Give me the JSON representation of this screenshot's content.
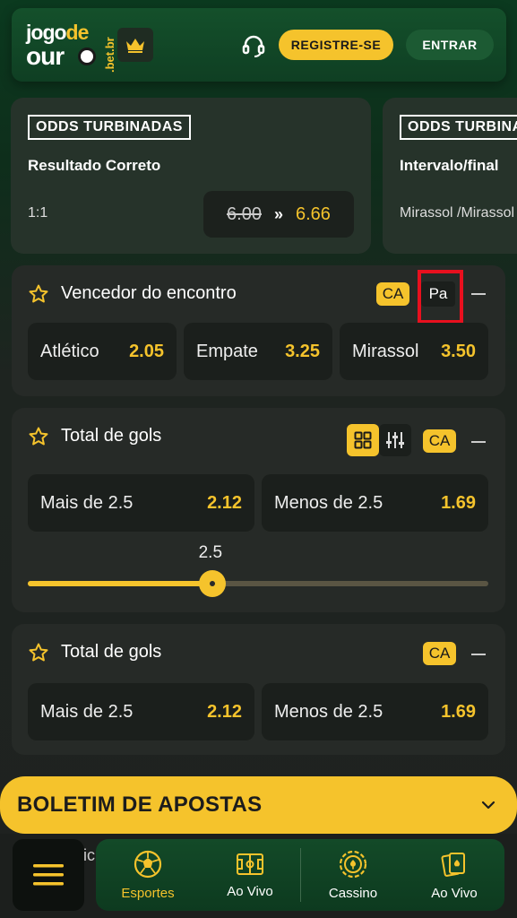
{
  "header": {
    "logo_line1_a": "jogo",
    "logo_line1_b": "de",
    "logo_line2": "our",
    "logo_suffix": ".bet.br",
    "register_label": "REGISTRE-SE",
    "login_label": "ENTRAR",
    "support_icon": "headset-icon",
    "crown_icon": "crown-icon"
  },
  "promos": [
    {
      "tag": "ODDS TURBINADAS",
      "title": "Resultado Correto",
      "selection": "1:1",
      "old_odd": "6.00",
      "arrow": "»",
      "new_odd": "6.66"
    },
    {
      "tag": "ODDS TURBINADAS",
      "title": "Intervalo/final",
      "selection": "Mirassol /Mirassol"
    }
  ],
  "markets": [
    {
      "title": "Vencedor do encontro",
      "badge_ca": "CA",
      "badge_pa": "Pa",
      "outcomes": [
        {
          "label": "Atlético",
          "odd": "2.05"
        },
        {
          "label": "Empate",
          "odd": "3.25"
        },
        {
          "label": "Mirassol",
          "odd": "3.50"
        }
      ]
    },
    {
      "title": "Total de gols",
      "badge_ca": "CA",
      "outcomes": [
        {
          "label": "Mais de 2.5",
          "odd": "2.12"
        },
        {
          "label": "Menos de 2.5",
          "odd": "1.69"
        }
      ],
      "slider_value": "2.5",
      "slider_position": 0.4
    },
    {
      "title": "Total de gols",
      "badge_ca": "CA",
      "outcomes": [
        {
          "label": "Mais de 2.5",
          "odd": "2.12"
        },
        {
          "label": "Menos de 2.5",
          "odd": "1.69"
        }
      ]
    }
  ],
  "betslip": {
    "title": "BOLETIM DE APOSTAS"
  },
  "bottom_nav": {
    "peek_text": "ic",
    "items": [
      {
        "label": "Esportes",
        "icon": "soccer-ball-icon",
        "active": true
      },
      {
        "label": "Ao Vivo",
        "icon": "field-icon"
      },
      {
        "label": "Cassino",
        "icon": "casino-chip-icon"
      },
      {
        "label": "Ao Vivo",
        "icon": "cards-icon"
      }
    ]
  },
  "colors": {
    "accent": "#f5c32c",
    "brand_green": "#14502b",
    "card_bg": "#262a27",
    "cell_bg": "#1b1f1c",
    "highlight_red": "#e8101e"
  }
}
